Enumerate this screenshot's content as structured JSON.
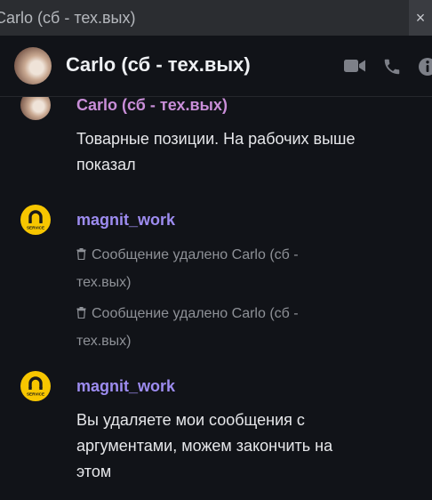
{
  "window": {
    "title": "Carlo (сб - тех.вых)",
    "close_glyph": "×"
  },
  "header": {
    "contact_name": "Carlo (сб - тех.вых)",
    "icons": [
      "video-camera-icon",
      "phone-icon",
      "info-icon"
    ]
  },
  "messages": [
    {
      "author": "Carlo (сб - тех.вых)",
      "author_color": "#c98ed8",
      "text": "Товарные позиции. На рабочих выше показал"
    },
    {
      "author": "magnit_work",
      "author_color": "#9d8cf0",
      "avatar_text": "SERVICE",
      "deleted": [
        "Сообщение удалено Carlo (сб - тех.вых)",
        "Сообщение удалено Carlo (сб - тех.вых)"
      ]
    },
    {
      "author": "magnit_work",
      "author_color": "#9d8cf0",
      "avatar_text": "SERVICE",
      "text": "Вы удаляете мои сообщения с аргументами, можем закончить на этом"
    }
  ],
  "colors": {
    "background": "#111318",
    "titlebar": "#2b2d31",
    "magnit_avatar": "#f7c600"
  }
}
